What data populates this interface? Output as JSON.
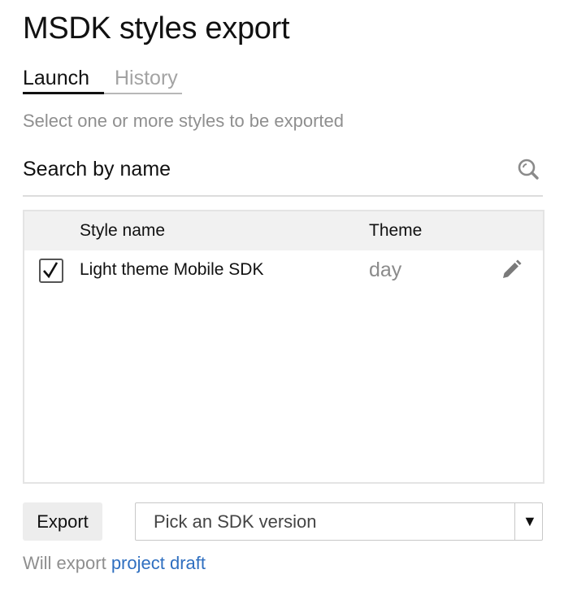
{
  "page": {
    "title": "MSDK styles export"
  },
  "tabs": [
    {
      "label": "Launch",
      "active": true
    },
    {
      "label": "History",
      "active": false
    }
  ],
  "hint": "Select one or more styles to be exported",
  "search": {
    "placeholder": "Search by name",
    "value": "",
    "icon": "search-icon"
  },
  "table": {
    "columns": [
      "Style name",
      "Theme"
    ],
    "rows": [
      {
        "checked": true,
        "style_name": "Light theme Mobile SDK",
        "theme": "day",
        "action_icon": "pencil-icon"
      }
    ]
  },
  "footer": {
    "export_label": "Export",
    "sdk_select": {
      "value": "Pick an SDK version",
      "arrow": "▼"
    },
    "note_prefix": "Will export",
    "note_link": "project draft"
  },
  "colors": {
    "link": "#2f6fc0",
    "muted_text": "#8f8f8f",
    "header_bg": "#f1f1f1",
    "button_bg": "#ededed"
  }
}
